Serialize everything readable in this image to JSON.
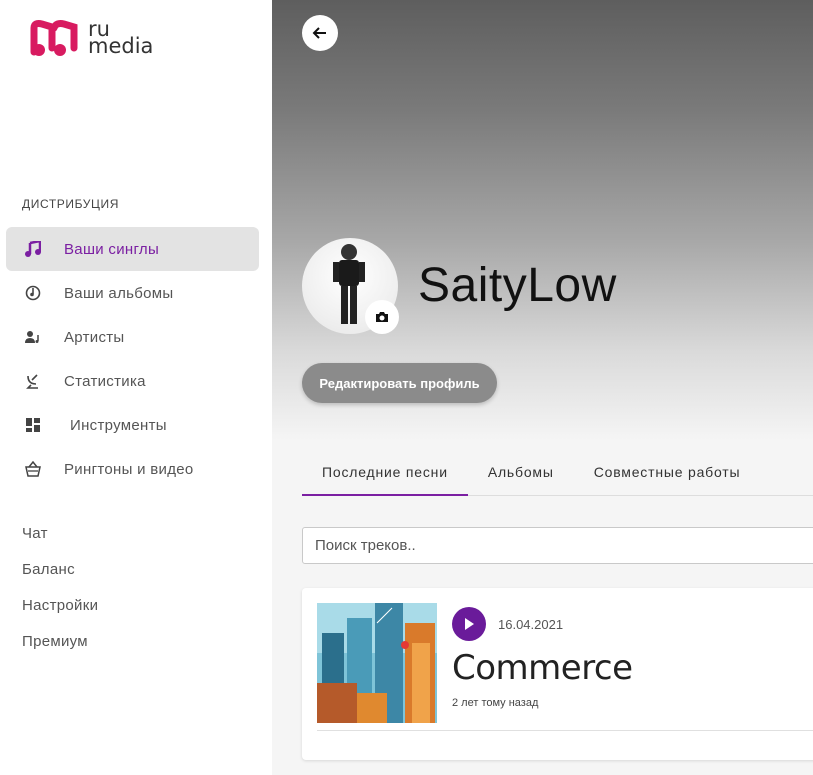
{
  "logo": {
    "line1": "ru",
    "line2": "media"
  },
  "sidebar": {
    "section_title": "ДИСТРИБУЦИЯ",
    "items": [
      {
        "label": "Ваши синглы",
        "icon": "music-note-icon",
        "active": true
      },
      {
        "label": "Ваши альбомы",
        "icon": "album-icon"
      },
      {
        "label": "Артисты",
        "icon": "artist-icon"
      },
      {
        "label": "Статистика",
        "icon": "satellite-icon"
      },
      {
        "label": "Инструменты",
        "icon": "dashboard-icon"
      },
      {
        "label": "Рингтоны и видео",
        "icon": "basket-icon"
      }
    ],
    "links": [
      "Чат",
      "Баланс",
      "Настройки",
      "Премиум"
    ]
  },
  "profile": {
    "name": "SaityLow",
    "edit_label": "Редактировать профиль"
  },
  "tabs": [
    "Последние песни",
    "Альбомы",
    "Совместные работы"
  ],
  "search": {
    "placeholder": "Поиск треков.."
  },
  "track": {
    "date": "16.04.2021",
    "title": "Commerce",
    "ago": "2 лет тому назад"
  },
  "colors": {
    "accent": "#7b1fa2",
    "play": "#6a1b9a",
    "logo": "#d81b60"
  }
}
